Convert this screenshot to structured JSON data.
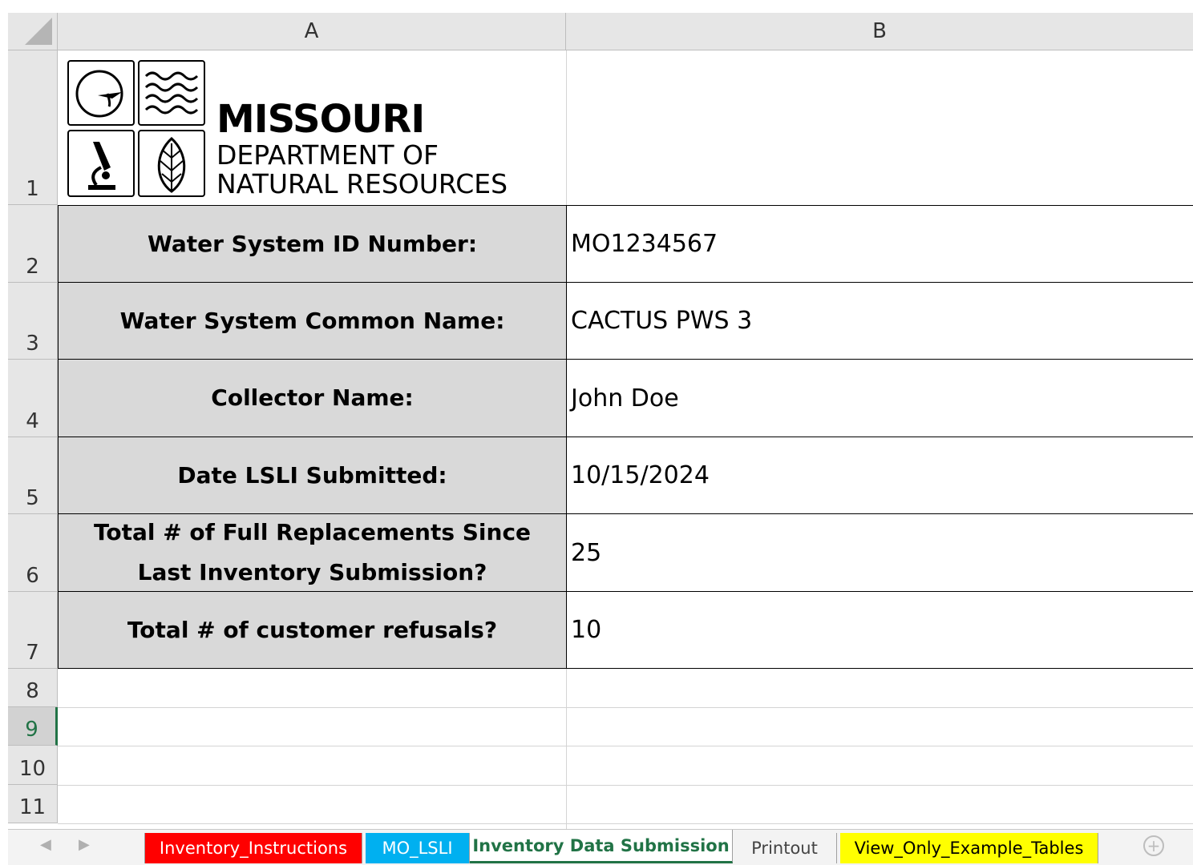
{
  "columns": [
    "A",
    "B"
  ],
  "rows": [
    "1",
    "2",
    "3",
    "4",
    "5",
    "6",
    "7",
    "8",
    "9",
    "10",
    "11"
  ],
  "logo": {
    "line1": "MISSOURI",
    "line2": "DEPARTMENT OF",
    "line3": "NATURAL RESOURCES"
  },
  "form": [
    {
      "label": "Water System ID Number:",
      "value": "MO1234567"
    },
    {
      "label": "Water System Common Name:",
      "value": "CACTUS PWS 3"
    },
    {
      "label": "Collector Name:",
      "value": "John Doe"
    },
    {
      "label": "Date LSLI Submitted:",
      "value": "10/15/2024"
    },
    {
      "label": "Total  # of Full Replacements Since Last Inventory Submission?",
      "value": "25"
    },
    {
      "label": "Total # of customer refusals?",
      "value": "10"
    }
  ],
  "tabs": [
    {
      "label": "Inventory_Instructions",
      "color": "#ff0000"
    },
    {
      "label": "MO_LSLI",
      "color": "#00b0f0"
    },
    {
      "label": "Inventory Data Submission",
      "color": "#ffffff",
      "active": true
    },
    {
      "label": "Printout",
      "color": "#f3f3f3"
    },
    {
      "label": "View_Only_Example_Tables",
      "color": "#ffff00"
    }
  ],
  "active_row": "9",
  "icons": [
    "prev-sheet-icon",
    "next-sheet-icon",
    "add-sheet-icon"
  ]
}
